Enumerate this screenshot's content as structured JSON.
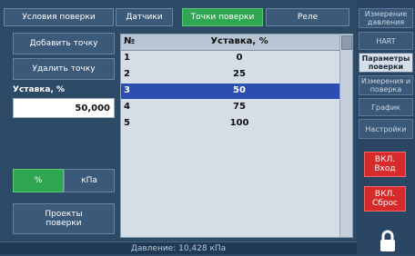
{
  "tabs": [
    {
      "label": "Условия поверки"
    },
    {
      "label": "Датчики"
    },
    {
      "label": "Точки поверки"
    },
    {
      "label": "Реле"
    }
  ],
  "left": {
    "add_label": "Добавить точку",
    "remove_label": "Удалить точку",
    "setpoint_label": "Уставка, %",
    "setpoint_value": "50,000",
    "unit_percent": "%",
    "unit_kpa": "кПа",
    "projects_label": "Проекты поверки"
  },
  "table": {
    "col_num": "№",
    "col_value": "Уставка, %",
    "rows": [
      {
        "n": "1",
        "v": "0"
      },
      {
        "n": "2",
        "v": "25"
      },
      {
        "n": "3",
        "v": "50"
      },
      {
        "n": "4",
        "v": "75"
      },
      {
        "n": "5",
        "v": "100"
      }
    ],
    "selected_row": 3
  },
  "right": {
    "items": [
      {
        "label": "Измерение давления"
      },
      {
        "label": "HART"
      },
      {
        "label": "Параметры поверки"
      },
      {
        "label": "Измерения и поверка"
      },
      {
        "label": "График"
      },
      {
        "label": "Настройки"
      }
    ],
    "enter_label": "ВКЛ. Вход",
    "reset_label": "ВКЛ. Сброс"
  },
  "status": {
    "text": "Давление: 10,428 кПа"
  },
  "colors": {
    "background": "#2d4a66",
    "tab_active": "#2fa652",
    "selection": "#2a4fb0",
    "red_button": "#d72b2b"
  },
  "icons": [
    "lock-icon"
  ]
}
